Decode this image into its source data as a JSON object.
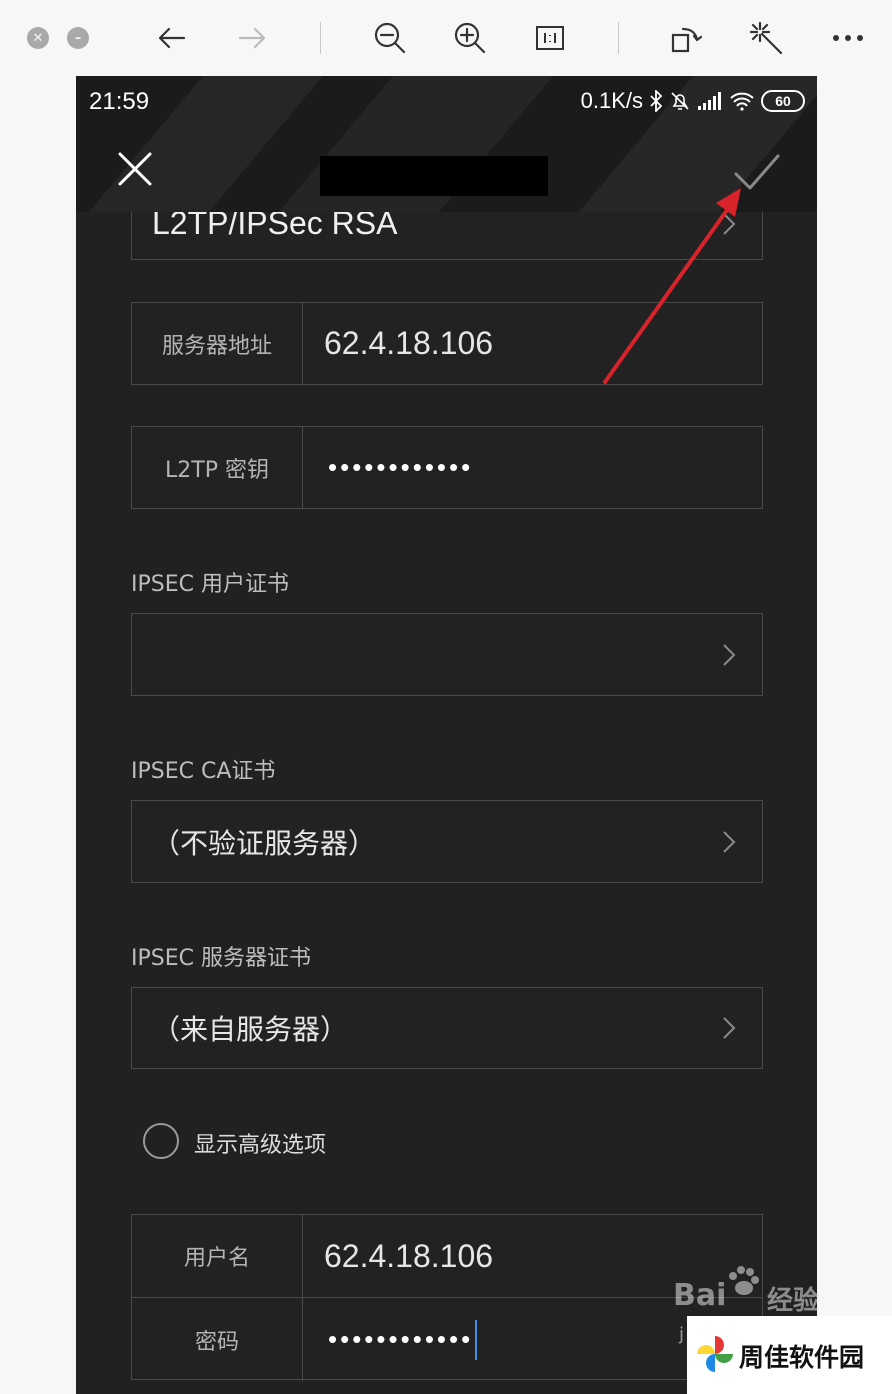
{
  "status_bar": {
    "time": "21:59",
    "net_speed": "0.1K/s",
    "battery": "60"
  },
  "form": {
    "vpn_type_value": "L2TP/IPSec RSA",
    "server_address": {
      "label": "服务器地址",
      "value": "62.4.18.106"
    },
    "l2tp_key": {
      "label": "L2TP 密钥",
      "value": "••••••••••••"
    },
    "ipsec_user_cert": {
      "label": "IPSEC 用户证书",
      "value": ""
    },
    "ipsec_ca_cert": {
      "label": "IPSEC CA证书",
      "value": "（不验证服务器）"
    },
    "ipsec_server_cert": {
      "label": "IPSEC 服务器证书",
      "value": "（来自服务器）"
    },
    "show_advanced": {
      "label": "显示高级选项"
    },
    "username": {
      "label": "用户名",
      "value": "62.4.18.106"
    },
    "password": {
      "label": "密码",
      "value": "••••••••••••"
    }
  },
  "watermark": {
    "baidu_text": "Bai",
    "jingyan_text": "经验",
    "brand_text": "周佳软件园",
    "url_fragment": "j"
  },
  "colors": {
    "phone_bg": "#212121",
    "annotation_arrow": "#d9232a",
    "text_cursor": "#3d8ee6"
  },
  "icons": {
    "toolbar": [
      "close-window-icon",
      "minimize-window-icon",
      "back-arrow-icon",
      "forward-arrow-icon",
      "zoom-out-icon",
      "zoom-in-icon",
      "actual-size-icon",
      "rotate-icon",
      "magic-wand-icon",
      "more-icon"
    ],
    "status": [
      "bluetooth-icon",
      "alarm-off-icon",
      "signal-icon",
      "wifi-icon",
      "battery-icon"
    ]
  }
}
